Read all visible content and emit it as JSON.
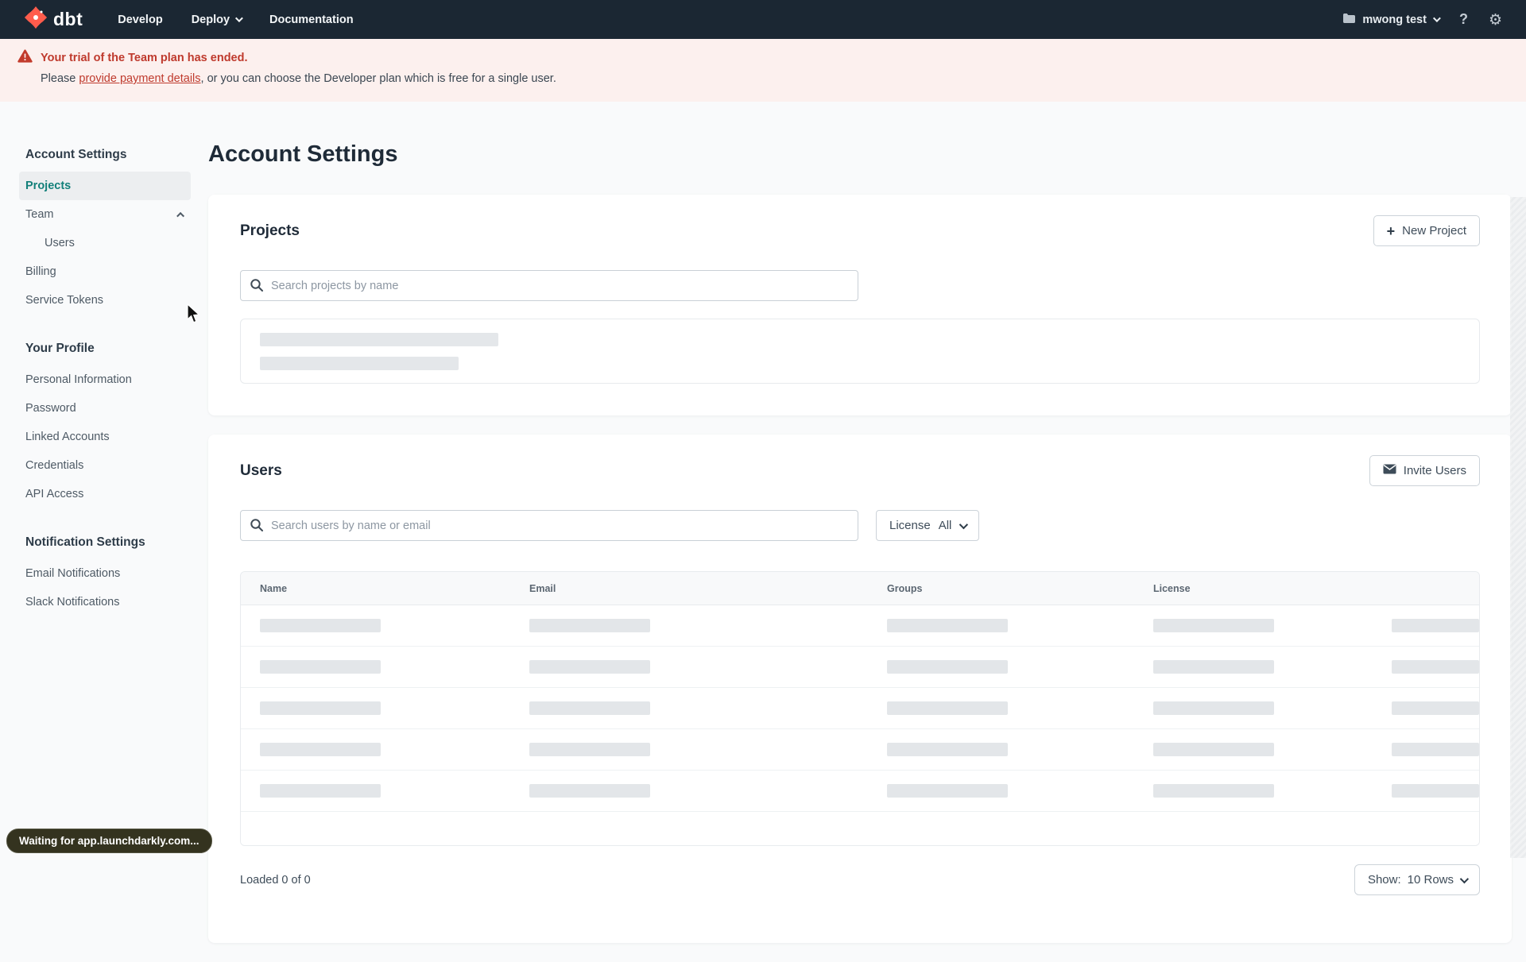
{
  "navbar": {
    "logo_text": "dbt",
    "menu": [
      {
        "label": "Develop"
      },
      {
        "label": "Deploy"
      },
      {
        "label": "Documentation"
      }
    ],
    "account_label": "mwong test",
    "icons": {
      "help": "?",
      "gear": "⚙"
    }
  },
  "banner": {
    "title": "Your trial of the Team plan has ended.",
    "body_prefix": "Please ",
    "link_text": "provide payment details",
    "body_suffix": ", or you can choose the Developer plan which is free for a single user."
  },
  "sidebar": {
    "sections": [
      {
        "heading": "Account Settings",
        "items": [
          {
            "label": "Projects"
          },
          {
            "label": "Team"
          },
          {
            "label": "Users"
          },
          {
            "label": "Billing"
          },
          {
            "label": "Service Tokens"
          }
        ]
      },
      {
        "heading": "Your Profile",
        "items": [
          {
            "label": "Personal Information"
          },
          {
            "label": "Password"
          },
          {
            "label": "Linked Accounts"
          },
          {
            "label": "Credentials"
          },
          {
            "label": "API Access"
          }
        ]
      },
      {
        "heading": "Notification Settings",
        "items": [
          {
            "label": "Email Notifications"
          },
          {
            "label": "Slack Notifications"
          }
        ]
      }
    ]
  },
  "main": {
    "page_title": "Account Settings",
    "projects": {
      "title": "Projects",
      "new_button": "New Project",
      "search_placeholder": "Search projects by name"
    },
    "users": {
      "title": "Users",
      "invite_button": "Invite Users",
      "search_placeholder": "Search users by name or email",
      "license_label": "License",
      "license_value": "All",
      "columns": [
        "Name",
        "Email",
        "Groups",
        "License"
      ],
      "skeleton_row_count": 5,
      "loaded_text": "Loaded 0 of 0",
      "show_label": "Show:",
      "show_value": "10 Rows"
    }
  },
  "status_tooltip": "Waiting for app.launchdarkly.com...",
  "colors": {
    "navbar_bg": "#1b2733",
    "brand_orange": "#ff5c4c",
    "accent_teal": "#12807a",
    "banner_bg": "#fcf0ee",
    "alert_red": "#bf3a2d",
    "skeleton_gray": "#e4e7ea"
  }
}
